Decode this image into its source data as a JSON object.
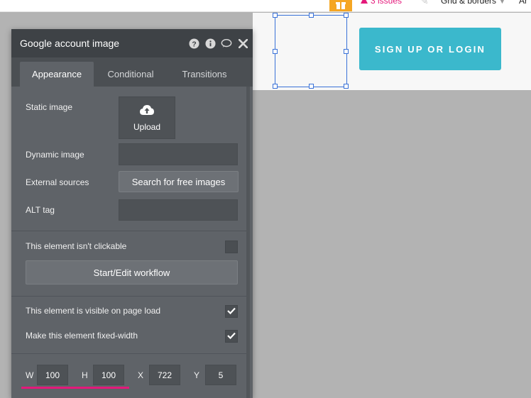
{
  "topbar": {
    "gift_icon": "gift-icon",
    "issues_label": "3 issues",
    "issues_color": "#e4197b",
    "grid_label": "Grid & borders",
    "truncated_label": "Ar"
  },
  "canvas": {
    "signup_label": "SIGN UP OR LOGIN",
    "signup_color": "#3bb8cc",
    "selection_color": "#3a72d8"
  },
  "panel": {
    "title": "Google account image",
    "header_icons": [
      "help-icon",
      "info-icon",
      "comment-icon",
      "close-icon"
    ],
    "tabs": [
      {
        "label": "Appearance",
        "active": true
      },
      {
        "label": "Conditional",
        "active": false
      },
      {
        "label": "Transitions",
        "active": false
      }
    ],
    "static_image_label": "Static image",
    "upload_label": "Upload",
    "dynamic_image_label": "Dynamic image",
    "dynamic_image_value": "",
    "external_sources_label": "External sources",
    "search_images_label": "Search for free images",
    "alt_tag_label": "ALT tag",
    "alt_tag_value": "",
    "not_clickable_label": "This element isn't clickable",
    "not_clickable_checked": false,
    "workflow_label": "Start/Edit workflow",
    "visible_label": "This element is visible on page load",
    "visible_checked": true,
    "fixed_width_label": "Make this element fixed-width",
    "fixed_width_checked": true,
    "dimensions": {
      "w_label": "W",
      "w_value": "100",
      "h_label": "H",
      "h_value": "100",
      "x_label": "X",
      "x_value": "722",
      "y_label": "Y",
      "y_value": "5"
    }
  }
}
